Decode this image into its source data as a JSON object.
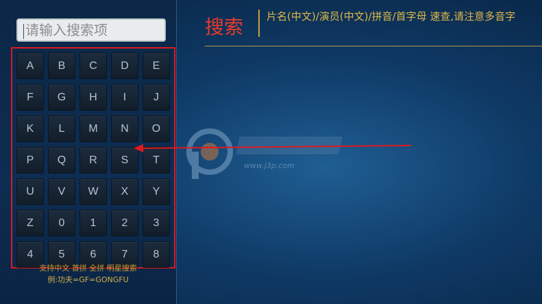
{
  "search": {
    "placeholder": "请输入搜索项"
  },
  "keyboard": {
    "keys": [
      "A",
      "B",
      "C",
      "D",
      "E",
      "F",
      "G",
      "H",
      "I",
      "J",
      "K",
      "L",
      "M",
      "N",
      "O",
      "P",
      "Q",
      "R",
      "S",
      "T",
      "U",
      "V",
      "W",
      "X",
      "Y",
      "Z",
      "0",
      "1",
      "2",
      "3",
      "4",
      "5",
      "6",
      "7",
      "8"
    ]
  },
  "hints": {
    "line1": "支持中文 首拼 全拼 明星搜索",
    "line2": "例:功夫=GF=GONGFU"
  },
  "header": {
    "title": "搜索",
    "description": "片名(中文)/演员(中文)/拼音/首字母 速查,请注意多音字"
  },
  "watermark": {
    "url": "www.j3p.com"
  },
  "colors": {
    "title": "#e83a2d",
    "accent_gold": "#e0b84a",
    "highlight_red": "#e0191e"
  }
}
